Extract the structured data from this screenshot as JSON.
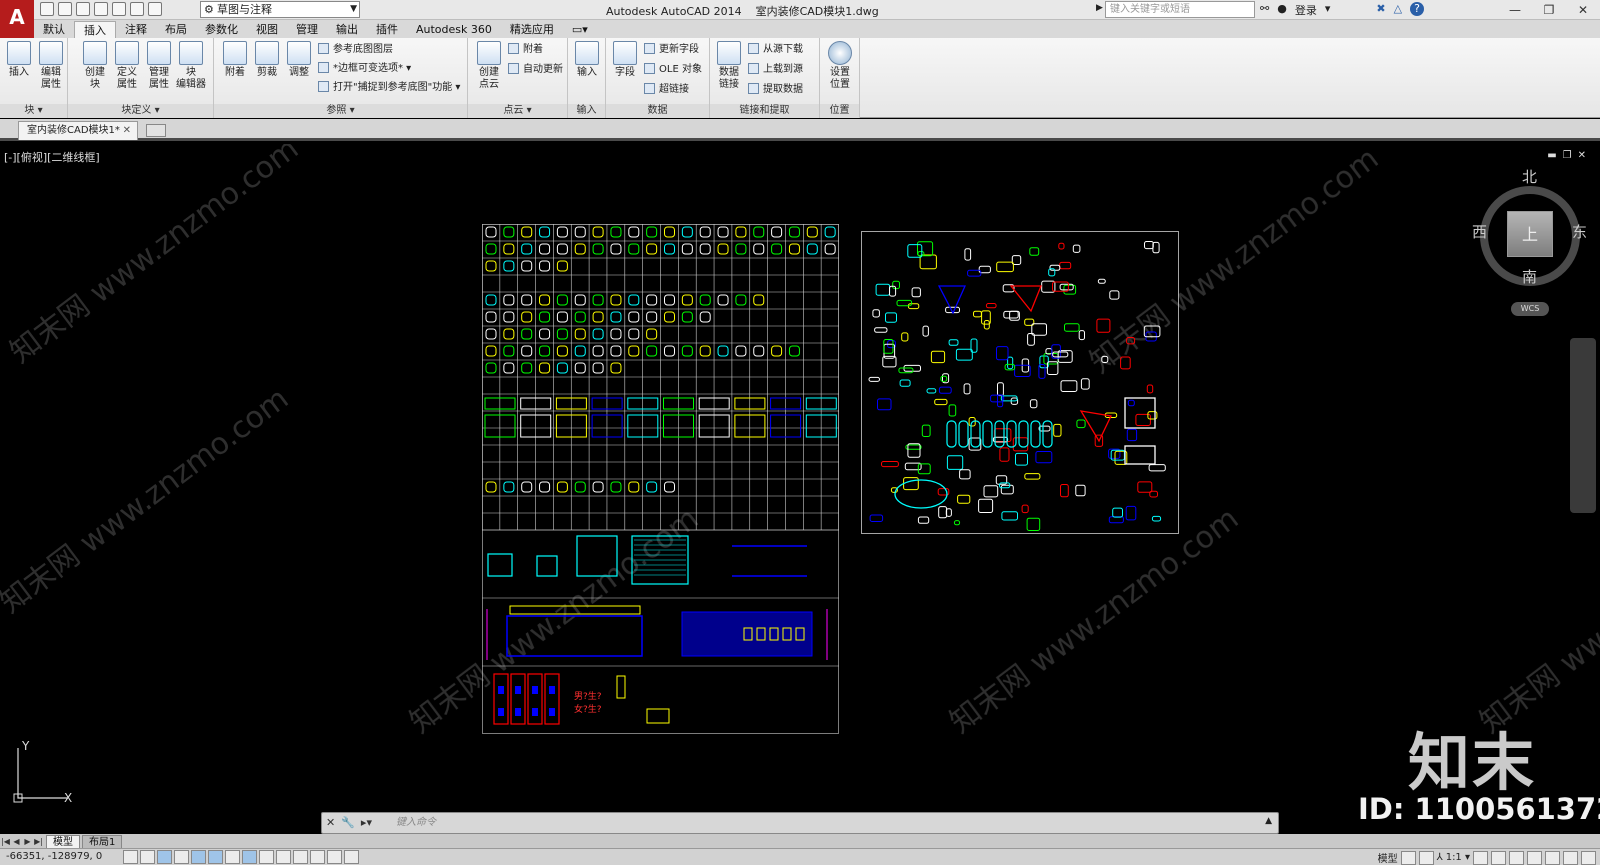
{
  "titlebar": {
    "app_logo": "A",
    "workspace": "草图与注释",
    "app_title": "Autodesk AutoCAD 2014",
    "file_title": "室内装修CAD模块1.dwg",
    "search_placeholder": "键入关键字或短语",
    "signin": "登录",
    "help": "?",
    "win_minimize": "—",
    "win_restore": "❐",
    "win_close": "✕"
  },
  "ribbon_tabs": [
    "默认",
    "插入",
    "注释",
    "布局",
    "参数化",
    "视图",
    "管理",
    "输出",
    "插件",
    "Autodesk 360",
    "精选应用"
  ],
  "ribbon_tab_active": "插入",
  "panels": {
    "block": {
      "title": "块 ▾",
      "insert": "插入",
      "edit_attr": "编辑\n属性"
    },
    "block_def": {
      "title": "块定义 ▾",
      "create": "创建\n块",
      "define_attr": "定义\n属性",
      "manage_attr": "管理\n属性",
      "block_editor": "块\n编辑器"
    },
    "reference": {
      "title": "参照 ▾",
      "attach": "附着",
      "clip": "剪裁",
      "adjust": "调整",
      "underlay_layers": "参考底图图层",
      "frame": "*边框可变选项* ▾",
      "snap": "打开\"捕捉到参考底图\"功能 ▾"
    },
    "point_cloud": {
      "title": "点云 ▾",
      "create": "创建\n点云",
      "attach": "附着",
      "auto_update": "自动更新"
    },
    "import": {
      "title": "输入",
      "import": "输入"
    },
    "data": {
      "title": "数据",
      "field": "字段",
      "update_fields": "更新字段",
      "ole": "OLE 对象",
      "hyperlink": "超链接"
    },
    "link_extract": {
      "title": "链接和提取",
      "data_link": "数据\n链接",
      "download": "从源下载",
      "upload": "上载到源",
      "extract": "提取数据"
    },
    "location": {
      "title": "位置",
      "set_location": "设置\n位置"
    }
  },
  "doc_tab": "室内装修CAD模块1*",
  "viewport": {
    "label": "[-][俯视][二维线框]",
    "compass": {
      "north": "北",
      "south": "南",
      "east": "东",
      "west": "西",
      "top": "上"
    },
    "wcs": "WCS",
    "ucs_x": "X",
    "ucs_y": "Y"
  },
  "watermark": {
    "brand": "知末",
    "id": "ID: 1100561372",
    "site": "知末网 www.znzmo.com"
  },
  "command_line": {
    "placeholder": "键入命令"
  },
  "layout_tabs": [
    "模型",
    "布局1"
  ],
  "layout_active": "模型",
  "status": {
    "coords": "-66351, -128979, 0",
    "model": "模型",
    "scale": "1:1 ▾"
  },
  "drawing_labels": {
    "question": "男?生?",
    "question2": "女?生?"
  },
  "colors": {
    "canvas": "#000000",
    "cad_white": "#ffffff",
    "cad_green": "#00ff00",
    "cad_cyan": "#00ffff",
    "cad_yellow": "#ffff00",
    "cad_red": "#ff0000",
    "cad_blue": "#0000ff",
    "cad_magenta": "#ff00ff",
    "brand_red": "#b51c1c"
  }
}
